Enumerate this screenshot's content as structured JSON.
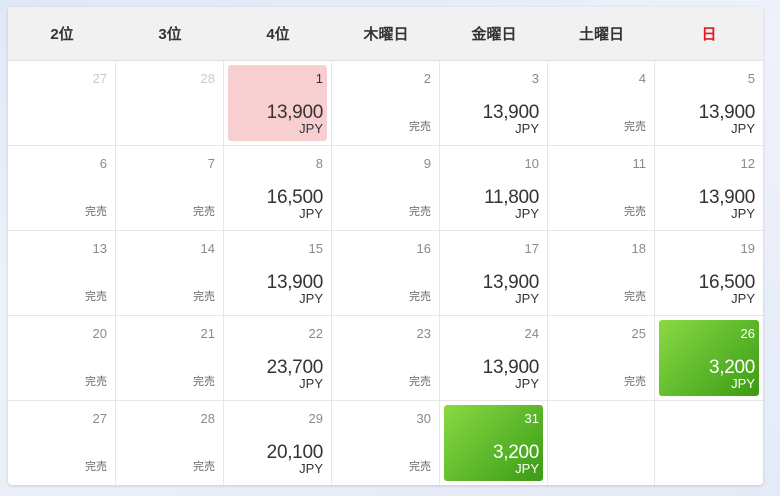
{
  "header": {
    "days": [
      {
        "label": "2位",
        "sunday": false
      },
      {
        "label": "3位",
        "sunday": false
      },
      {
        "label": "4位",
        "sunday": false
      },
      {
        "label": "木曜日",
        "sunday": false
      },
      {
        "label": "金曜日",
        "sunday": false
      },
      {
        "label": "土曜日",
        "sunday": false
      },
      {
        "label": "日",
        "sunday": true
      }
    ]
  },
  "currency": "JPY",
  "sold_out_label": "完売",
  "colors": {
    "sunday_header": "#e8151d",
    "highlight_pink": "#f8cfd0",
    "highlight_green": "#5cb82a"
  },
  "cells": [
    {
      "day": "27",
      "other": true
    },
    {
      "day": "28",
      "other": true
    },
    {
      "day": "1",
      "price": "13,900",
      "style": "pink"
    },
    {
      "day": "2",
      "sold": true
    },
    {
      "day": "3",
      "price": "13,900"
    },
    {
      "day": "4",
      "sold": true
    },
    {
      "day": "5",
      "price": "13,900"
    },
    {
      "day": "6",
      "sold": true
    },
    {
      "day": "7",
      "sold": true
    },
    {
      "day": "8",
      "price": "16,500"
    },
    {
      "day": "9",
      "sold": true
    },
    {
      "day": "10",
      "price": "11,800"
    },
    {
      "day": "11",
      "sold": true
    },
    {
      "day": "12",
      "price": "13,900"
    },
    {
      "day": "13",
      "sold": true
    },
    {
      "day": "14",
      "sold": true
    },
    {
      "day": "15",
      "price": "13,900"
    },
    {
      "day": "16",
      "sold": true
    },
    {
      "day": "17",
      "price": "13,900"
    },
    {
      "day": "18",
      "sold": true
    },
    {
      "day": "19",
      "price": "16,500"
    },
    {
      "day": "20",
      "sold": true
    },
    {
      "day": "21",
      "sold": true
    },
    {
      "day": "22",
      "price": "23,700"
    },
    {
      "day": "23",
      "sold": true
    },
    {
      "day": "24",
      "price": "13,900"
    },
    {
      "day": "25",
      "sold": true
    },
    {
      "day": "26",
      "price": "3,200",
      "style": "green"
    },
    {
      "day": "27",
      "sold": true
    },
    {
      "day": "28",
      "sold": true
    },
    {
      "day": "29",
      "price": "20,100"
    },
    {
      "day": "30",
      "sold": true
    },
    {
      "day": "31",
      "price": "3,200",
      "style": "green"
    },
    {
      "empty": true
    },
    {
      "empty": true
    }
  ]
}
